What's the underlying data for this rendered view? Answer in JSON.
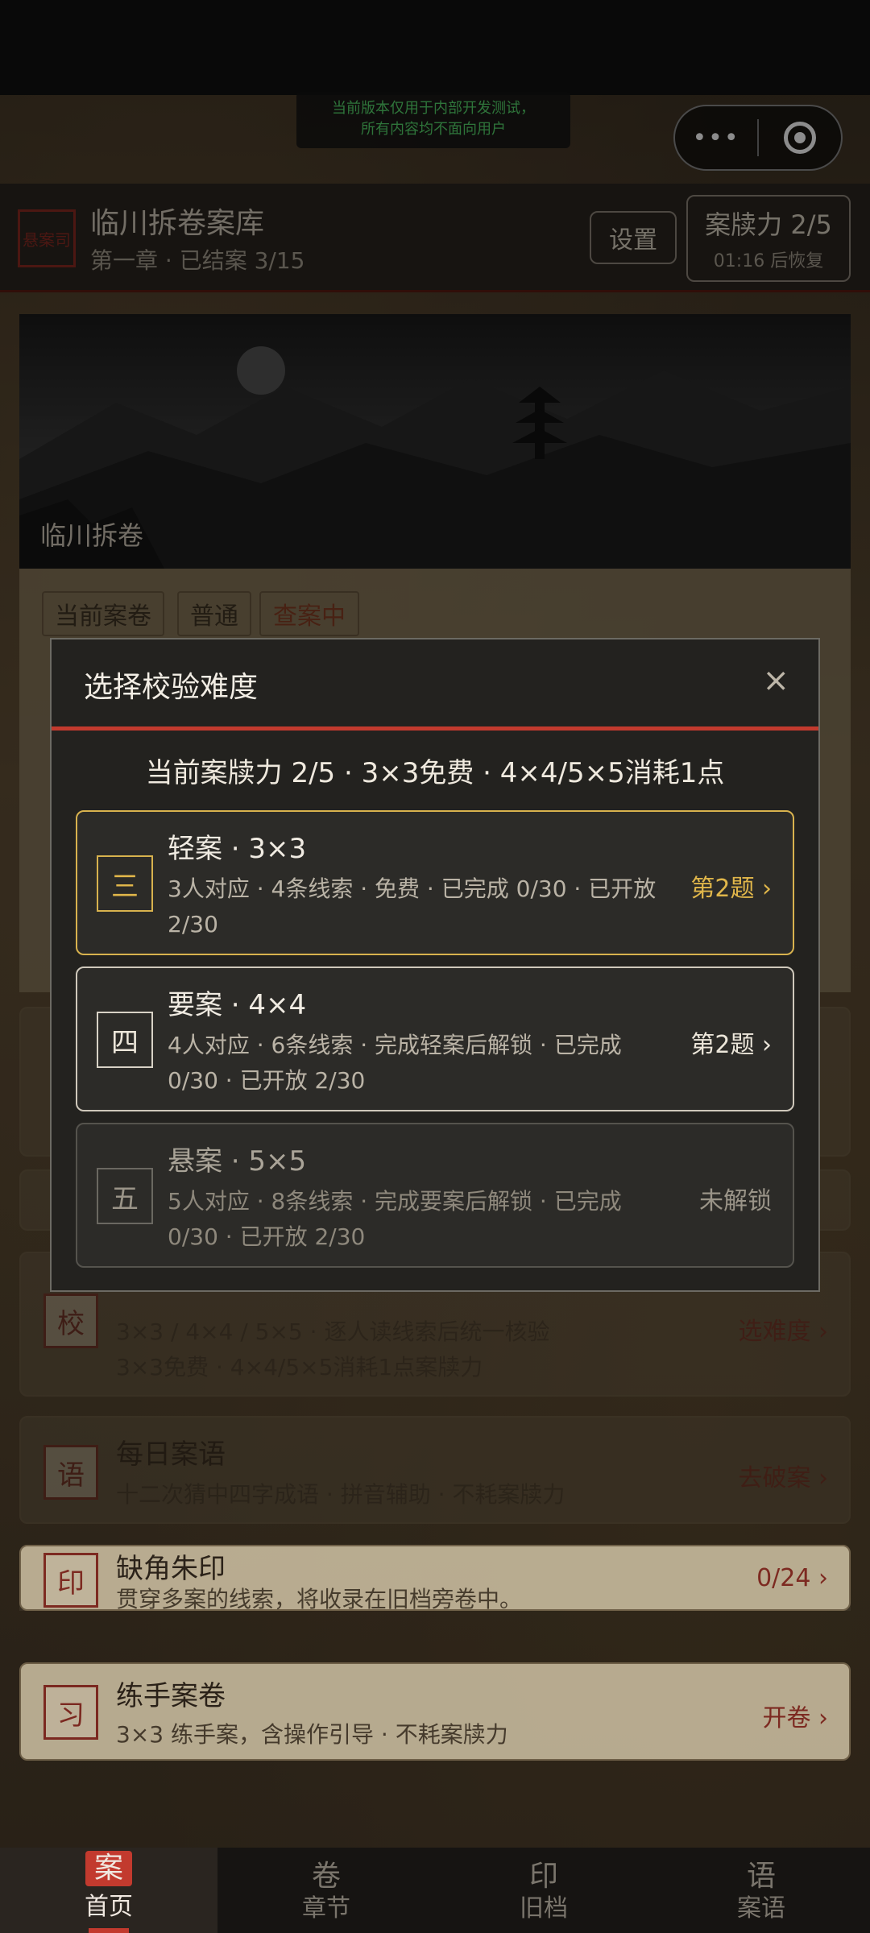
{
  "dev_notice": {
    "line1": "当前版本仅用于内部开发测试，",
    "line2": "所有内容均不面向用户"
  },
  "capsule": {
    "more_icon": "more-dots-icon",
    "target_icon": "target-icon"
  },
  "header": {
    "seal": "悬案司",
    "title": "临川拆卷案库",
    "subtitle": "第一章 · 已结案 3/15",
    "settings_label": "设置",
    "stamina": "案牍力 2/5",
    "recover": "01:16 后恢复"
  },
  "hero": {
    "caption": "临川拆卷"
  },
  "tags": [
    "当前案卷",
    "普通",
    "查案中"
  ],
  "cards": [
    {
      "icon": "校",
      "title": "",
      "desc": "3×3 / 4×4 / 5×5 · 逐人读线索后统一核验",
      "desc2": "3×3免费 · 4×4/5×5消耗1点案牍力",
      "action": "选难度 ›"
    },
    {
      "icon": "语",
      "title": "每日案语",
      "desc": "十二次猜中四字成语 · 拼音辅助 · 不耗案牍力",
      "action": "去破案 ›"
    },
    {
      "icon": "印",
      "title": "缺角朱印",
      "desc": "贯穿多案的线索，将收录在旧档旁卷中。",
      "action": "0/24 ›"
    },
    {
      "icon": "习",
      "title": "练手案卷",
      "desc": "3×3 练手案，含操作引导 · 不耗案牍力",
      "action": "开卷 ›"
    }
  ],
  "nav": [
    {
      "glyph": "案",
      "label": "首页",
      "active": true
    },
    {
      "glyph": "卷",
      "label": "章节"
    },
    {
      "glyph": "印",
      "label": "旧档"
    },
    {
      "glyph": "语",
      "label": "案语"
    }
  ],
  "modal": {
    "title": "选择校验难度",
    "close": "×",
    "summary": "当前案牍力 2/5 · 3×3免费 · 4×4/5×5消耗1点",
    "options": [
      {
        "badge": "三",
        "name": "轻案 · 3×3",
        "desc": "3人对应 · 4条线索 · 免费 · 已完成 0/30 · 已开放 2/30",
        "action": "第2题 ›",
        "state": "selected"
      },
      {
        "badge": "四",
        "name": "要案 · 4×4",
        "desc": "4人对应 · 6条线索 · 完成轻案后解锁 · 已完成 0/30 · 已开放 2/30",
        "action": "第2题 ›",
        "state": "available"
      },
      {
        "badge": "五",
        "name": "悬案 · 5×5",
        "desc": "5人对应 · 8条线索 · 完成要案后解锁 · 已完成 0/30 · 已开放 2/30",
        "action": "未解锁",
        "state": "locked"
      }
    ]
  },
  "colors": {
    "accent_red": "#c23a2e",
    "gold": "#e0b64a",
    "selected_border": "#d8b24e"
  }
}
